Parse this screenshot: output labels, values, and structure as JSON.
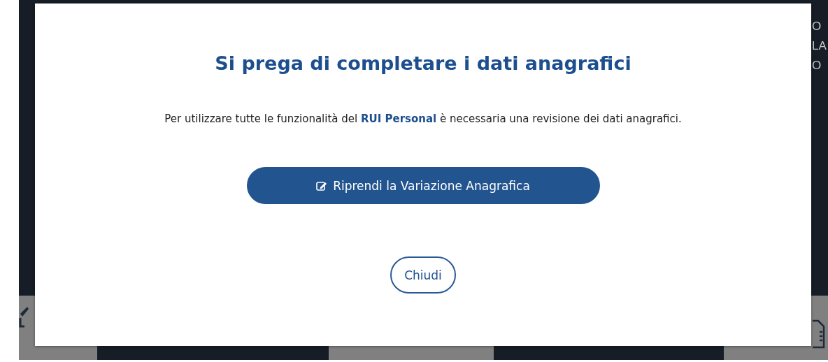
{
  "background": {
    "edge_texts": [
      "O",
      "LA",
      "O"
    ]
  },
  "dialog": {
    "title": "Si prega di completare i dati anagrafici",
    "message": "Per utilizzare tutte le funzionalità del **RUI Personal** è necessaria una revisione dei dati anagrafici.",
    "primary_button": "Riprendi la Variazione Anagrafica",
    "close_button": "Chiudi"
  }
}
